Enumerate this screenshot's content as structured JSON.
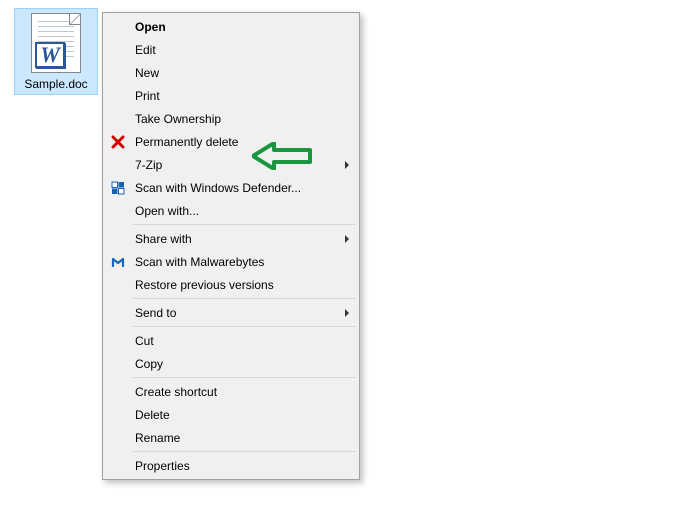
{
  "file": {
    "name": "Sample.doc"
  },
  "menu": {
    "open": "Open",
    "edit": "Edit",
    "new": "New",
    "print": "Print",
    "take_ownership": "Take Ownership",
    "permanently_delete": "Permanently delete",
    "seven_zip": "7-Zip",
    "scan_defender": "Scan with Windows Defender...",
    "open_with": "Open with...",
    "share_with": "Share with",
    "scan_malwarebytes": "Scan with Malwarebytes",
    "restore_versions": "Restore previous versions",
    "send_to": "Send to",
    "cut": "Cut",
    "copy": "Copy",
    "create_shortcut": "Create shortcut",
    "delete": "Delete",
    "rename": "Rename",
    "properties": "Properties"
  },
  "colors": {
    "annotation": "#1a9641",
    "selection": "#cce8ff",
    "word_blue": "#2b579a",
    "delete_red": "#d40000",
    "defender_blue": "#1a5fb4",
    "malwarebytes_blue": "#1566c0"
  }
}
